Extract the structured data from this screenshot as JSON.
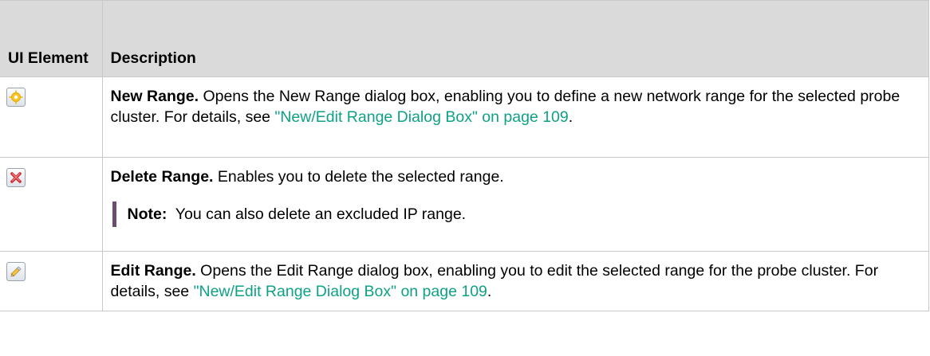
{
  "header": {
    "col1": "UI Element",
    "col2": "Description"
  },
  "rows": [
    {
      "icon": "new-sparkle-icon",
      "title": "New Range.",
      "text": " Opens the New Range dialog box, enabling you to define a new network range for the selected probe cluster. For details, see ",
      "link": "\"New/Edit Range Dialog Box\" on page 109",
      "end": "."
    },
    {
      "icon": "delete-x-icon",
      "title": "Delete Range.",
      "text": " Enables you to delete the selected range.",
      "note_label": "Note:",
      "note_text": "  You can also delete an excluded IP range."
    },
    {
      "icon": "edit-pencil-icon",
      "title": "Edit Range.",
      "text": " Opens the Edit Range dialog box, enabling you to edit the selected range for the probe cluster. For details, see ",
      "link": "\"New/Edit Range Dialog Box\" on page 109",
      "end": "."
    }
  ],
  "colors": {
    "header_bg": "#dadada",
    "link": "#0ea185",
    "note_bar": "#6c4d6e"
  }
}
